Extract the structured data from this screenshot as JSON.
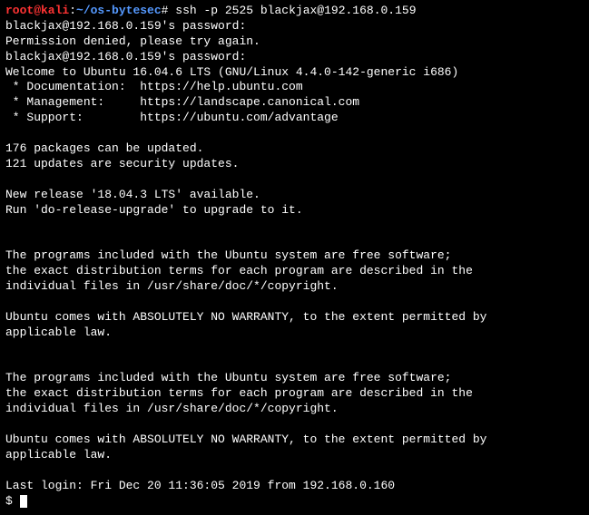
{
  "prompt": {
    "user": "root@kali",
    "sep1": ":",
    "path": "~/os-bytesec",
    "hash": "# ",
    "command": "ssh -p 2525 blackjax@192.168.0.159"
  },
  "lines": {
    "pw1": "blackjax@192.168.0.159's password:",
    "denied": "Permission denied, please try again.",
    "pw2": "blackjax@192.168.0.159's password:",
    "welcome": "Welcome to Ubuntu 16.04.6 LTS (GNU/Linux 4.4.0-142-generic i686)",
    "blank": "",
    "doc": " * Documentation:  https://help.ubuntu.com",
    "mgmt": " * Management:     https://landscape.canonical.com",
    "support": " * Support:        https://ubuntu.com/advantage",
    "pkg": "176 packages can be updated.",
    "sec": "121 updates are security updates.",
    "newrel": "New release '18.04.3 LTS' available.",
    "dorelcmd": "Run 'do-release-upgrade' to upgrade to it.",
    "prog1": "The programs included with the Ubuntu system are free software;",
    "prog2": "the exact distribution terms for each program are described in the",
    "prog3": "individual files in /usr/share/doc/*/copyright.",
    "warr1": "Ubuntu comes with ABSOLUTELY NO WARRANTY, to the extent permitted by",
    "warr2": "applicable law.",
    "lastlogin": "Last login: Fri Dec 20 11:36:05 2019 from 192.168.0.160",
    "dollar": "$ "
  }
}
